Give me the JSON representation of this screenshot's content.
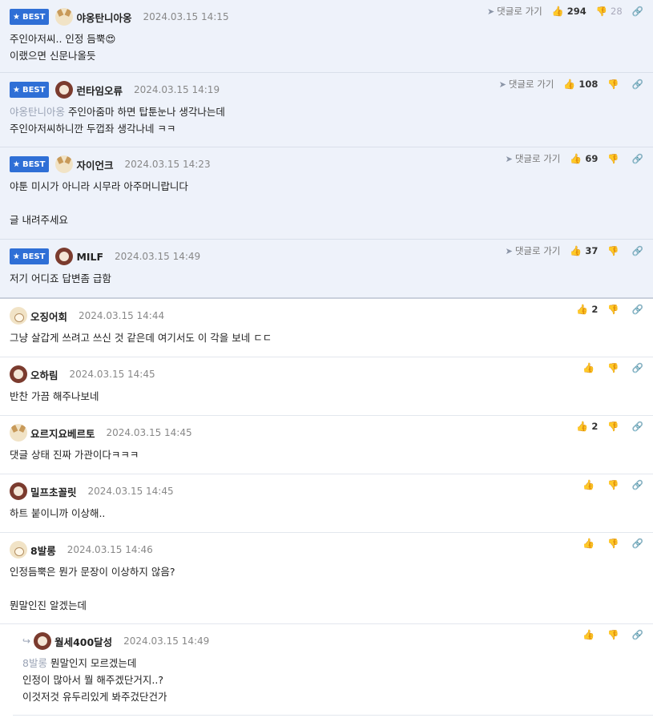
{
  "badge_label": "BEST",
  "goto_label": "댓글로 가기",
  "comments": [
    {
      "nick": "야옹탄니아옹",
      "date": "2024.03.15 14:15",
      "up": "294",
      "down": "28",
      "line1": "주인아저씨.. 인정 듬뿍😍",
      "line2": "이랬으면 신문나올듯"
    },
    {
      "nick": "런타임오류",
      "date": "2024.03.15 14:19",
      "up": "108",
      "down": "",
      "mention": "야옹탄니아옹",
      "line1": "주인아줌마 하면 탑툰눈나 생각나는데",
      "line2": "주인아저씨하니깐 두껍좌 생각나네 ㅋㅋ"
    },
    {
      "nick": "자이언크",
      "date": "2024.03.15 14:23",
      "up": "69",
      "down": "",
      "line1": "야툰 미시가 아니라 시무라 아주머니랍니다",
      "line2": "",
      "line3": "글 내려주세요"
    },
    {
      "nick": "MILF",
      "date": "2024.03.15 14:49",
      "up": "37",
      "down": "",
      "line1": "저기 어디죠 답변좀 급함"
    },
    {
      "nick": "오징어회",
      "date": "2024.03.15 14:44",
      "up": "2",
      "line1": "그냥 살갑게 쓰려고 쓰신 것 같은데 여기서도 이 각을 보네 ㄷㄷ"
    },
    {
      "nick": "오하림",
      "date": "2024.03.15 14:45",
      "up": "",
      "line1": "반찬 가끔 해주나보네"
    },
    {
      "nick": "요르지요베르토",
      "date": "2024.03.15 14:45",
      "up": "2",
      "line1": "댓글 상태 진짜 가관이다ㅋㅋㅋ"
    },
    {
      "nick": "밀프초꼴릿",
      "date": "2024.03.15 14:45",
      "up": "",
      "line1": "하트 붙이니까 이상해.."
    },
    {
      "nick": "8발롱",
      "date": "2024.03.15 14:46",
      "up": "",
      "line1": "인정듬뿍은 뭔가 문장이 이상하지 않음?",
      "line2": "",
      "line3": "뭔말인진 알겠는데"
    },
    {
      "nick": "월세400달성",
      "date": "2024.03.15 14:49",
      "up": "",
      "mention": "8발롱",
      "line1": "뭔말인지 모르겠는데",
      "line2": "인정이 많아서 뭘 해주겠단거지..?",
      "line3": "이것저것 유두리있게 봐주겄단건가"
    }
  ]
}
